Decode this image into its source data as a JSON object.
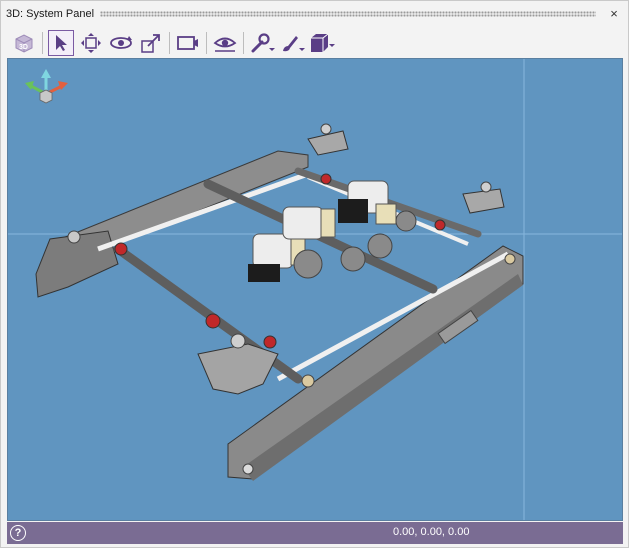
{
  "panel": {
    "title": "3D: System Panel",
    "close_symbol": "×"
  },
  "toolbar": {
    "buttons": [
      {
        "name": "3d-view-icon",
        "selected": false
      },
      {
        "name": "select-arrow-icon",
        "selected": true
      },
      {
        "name": "pan-icon",
        "selected": false
      },
      {
        "name": "orbit-icon",
        "selected": false
      },
      {
        "name": "zoom-extents-icon",
        "selected": false
      },
      {
        "name": "camera-icon",
        "selected": false
      },
      {
        "name": "visibility-eye-icon",
        "selected": false
      },
      {
        "name": "wrench-icon",
        "has_dropdown": true
      },
      {
        "name": "paintbrush-icon",
        "has_dropdown": true
      },
      {
        "name": "solid-box-icon",
        "has_dropdown": true
      }
    ],
    "icon_color": "#7a5aa3"
  },
  "viewport": {
    "background": "#6095c0",
    "content": "3D assembly model of a seat-track mechanism with motors, rods and brackets",
    "axis_triad": [
      "x",
      "y",
      "z"
    ]
  },
  "status": {
    "help_symbol": "?",
    "coordinates": "0.00, 0.00, 0.00",
    "background": "#7a6c93"
  }
}
